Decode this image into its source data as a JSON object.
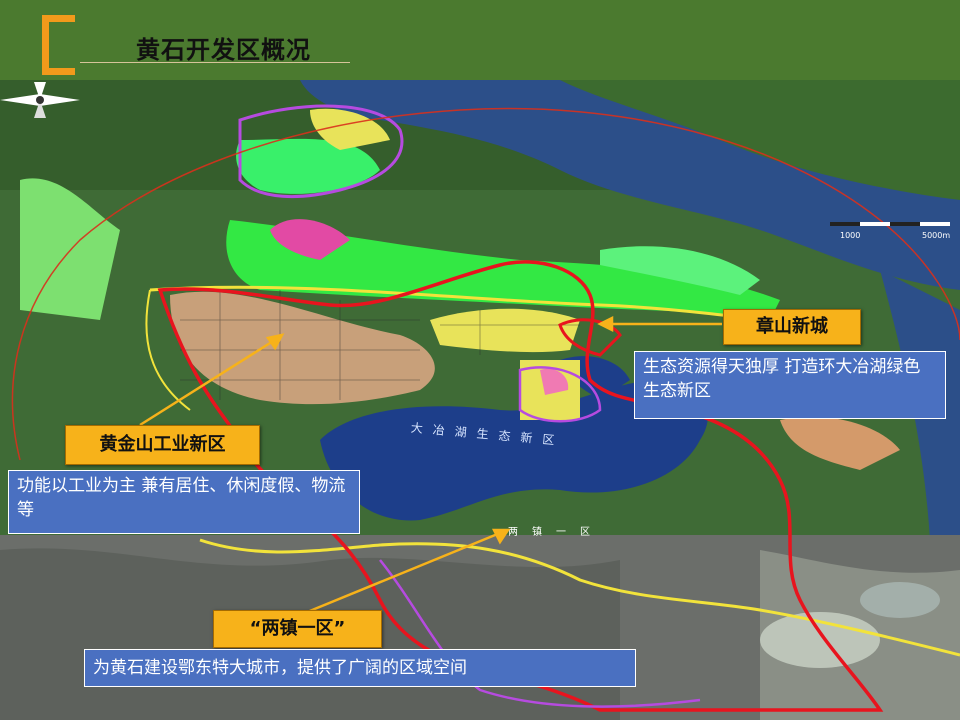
{
  "slide": {
    "title": "黄石开发区概况"
  },
  "callouts": {
    "zhangshan": {
      "label": "章山新城",
      "description": "生态资源得天独厚 打造环大冶湖绿色生态新区"
    },
    "huangjinshan": {
      "label": "黄金山工业新区",
      "description": "功能以工业为主 兼有居住、休闲度假、物流等"
    },
    "liangzhen": {
      "label": "“两镇一区”",
      "description": "为黄石建设鄂东特大城市，提供了广阔的区域空间"
    }
  },
  "map_labels": {
    "lake": "大冶湖生态新区",
    "liangzhen_line": "两镇一区",
    "scale_left": "1000",
    "scale_right": "5000m"
  },
  "colors": {
    "header_green": "#4b7a2f",
    "accent_orange": "#f29a1b",
    "callout_fill": "#f7b21a",
    "desc_fill": "#4a70c1",
    "boundary_red": "#e8141e",
    "boundary_yellow": "#f2e33b",
    "water_blue": "#1d3e8a"
  }
}
